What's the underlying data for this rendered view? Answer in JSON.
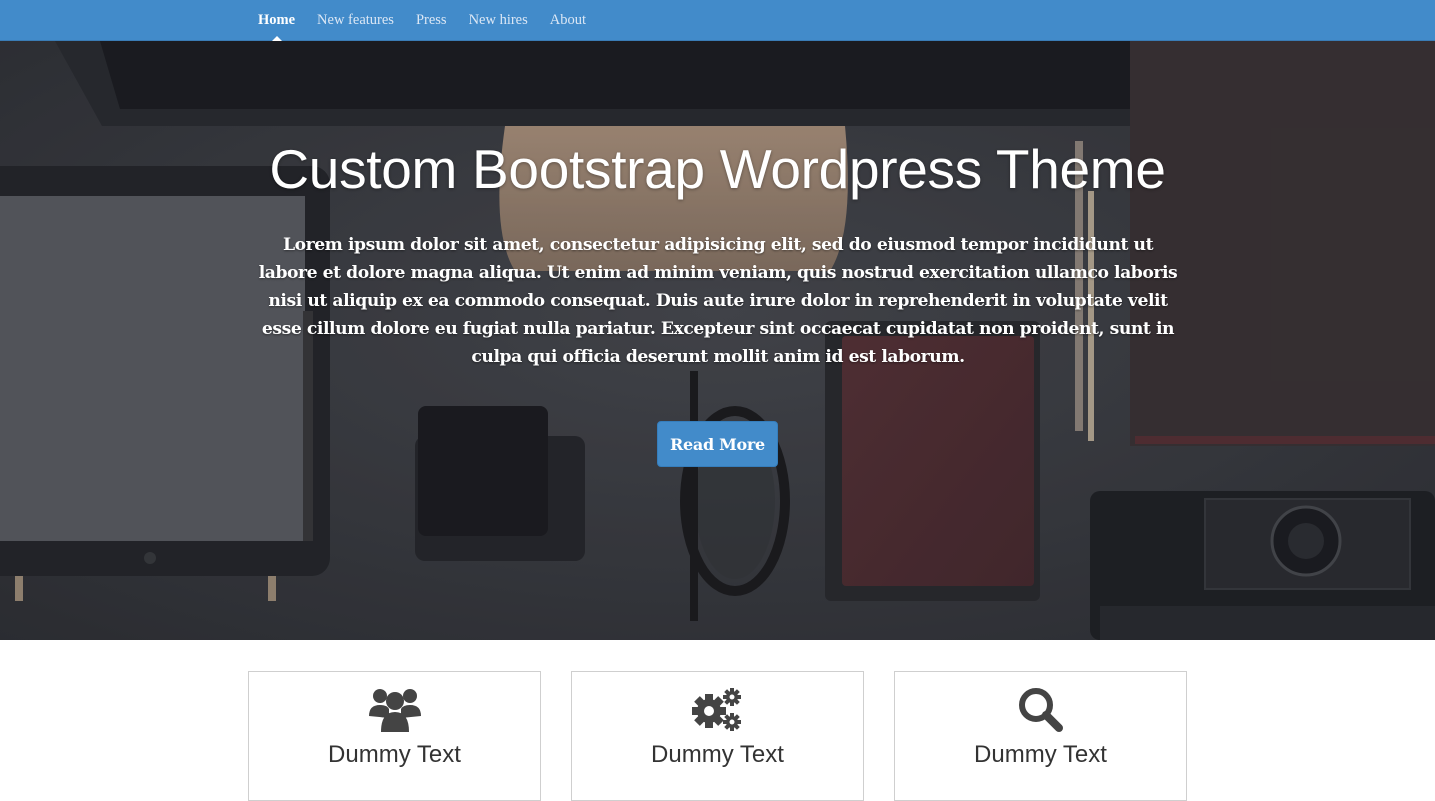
{
  "nav": {
    "items": [
      {
        "label": "Home",
        "active": true
      },
      {
        "label": "New features"
      },
      {
        "label": "Press"
      },
      {
        "label": "New hires"
      },
      {
        "label": "About"
      }
    ]
  },
  "hero": {
    "title": "Custom Bootstrap Wordpress Theme",
    "text": "Lorem ipsum dolor sit amet, consectetur adipisicing elit, sed do eiusmod tempor incididunt ut labore et dolore magna aliqua. Ut enim ad minim veniam, quis nostrud exercitation ullamco laboris nisi ut aliquip ex ea commodo consequat. Duis aute irure dolor in reprehenderit in voluptate velit esse cillum dolore eu fugiat nulla pariatur. Excepteur sint occaecat cupidatat non proident, sunt in culpa qui officia deserunt mollit anim id est laborum.",
    "button_label": "Read More"
  },
  "features": [
    {
      "icon": "users-icon",
      "label": "Dummy Text"
    },
    {
      "icon": "gears-icon",
      "label": "Dummy Text"
    },
    {
      "icon": "search-icon",
      "label": "Dummy Text"
    }
  ],
  "colors": {
    "navbar": "#428bca",
    "button": "#428bca",
    "icon": "#444444",
    "feature_text": "#333333"
  }
}
